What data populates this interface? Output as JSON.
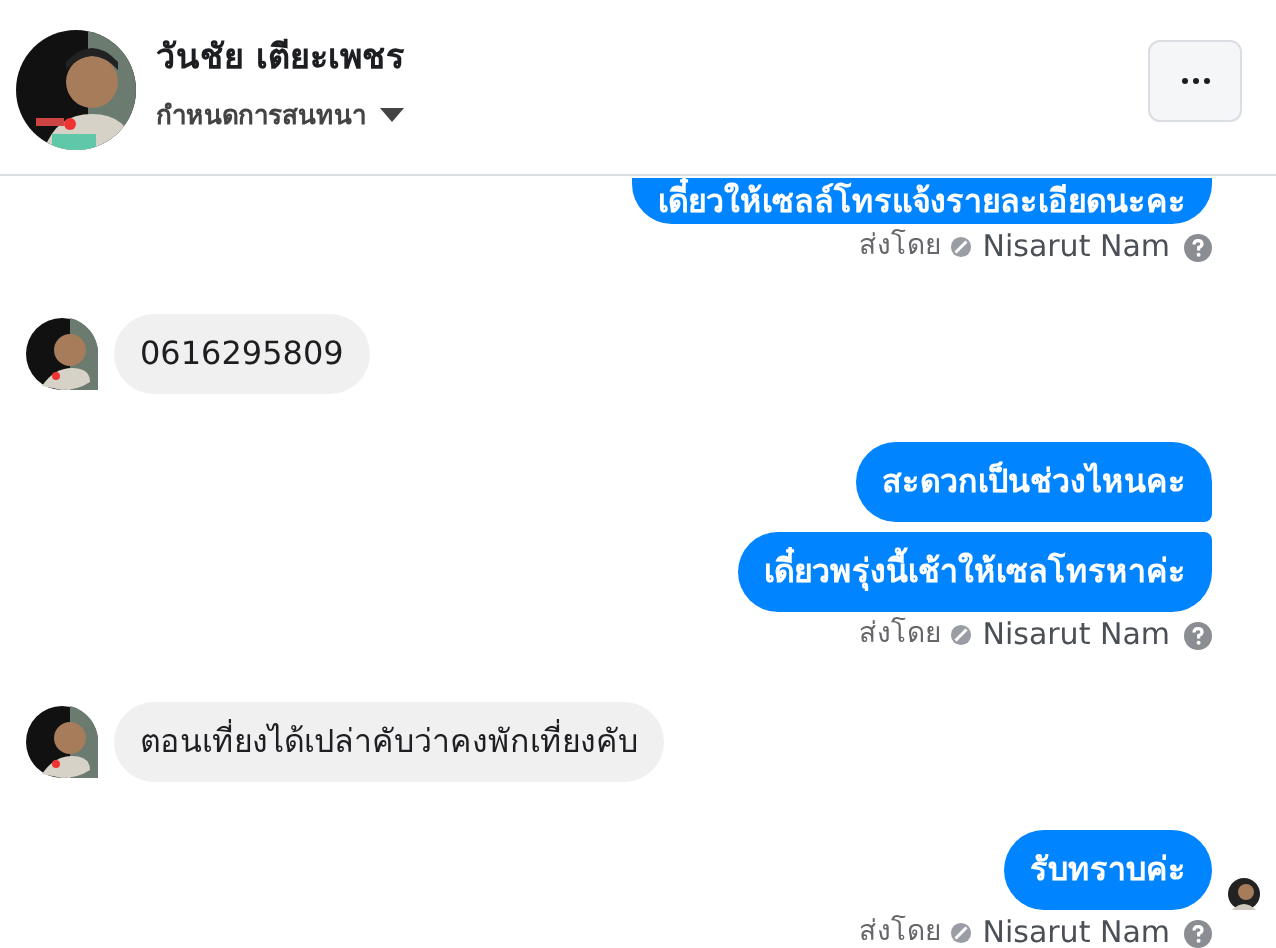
{
  "header": {
    "name": "วันชัย เตียะเพชร",
    "subtitle": "กำหนดการสนทนา"
  },
  "messages": [
    {
      "kind": "sent",
      "text": "เดี๋ยวให้เซลล์โทรแจ้งรายละเอียดนะคะ",
      "seen": false
    },
    {
      "kind": "note",
      "label": "ส่งโดย",
      "sender": "Nisarut Nam"
    },
    {
      "kind": "received",
      "text": "0616295809"
    },
    {
      "kind": "sent",
      "text": "สะดวกเป็นช่วงไหนคะ",
      "seen": false
    },
    {
      "kind": "sent",
      "text": "เดี๋ยวพรุ่งนี้เช้าให้เซลโทรหาค่ะ",
      "seen": false
    },
    {
      "kind": "note",
      "label": "ส่งโดย",
      "sender": "Nisarut Nam"
    },
    {
      "kind": "received",
      "text": "ตอนเที่ยงได้เปล่าคับว่าคงพักเที่ยงคับ"
    },
    {
      "kind": "sent",
      "text": "รับทราบค่ะ",
      "seen": true
    },
    {
      "kind": "note",
      "label": "ส่งโดย",
      "sender": "Nisarut Nam"
    }
  ]
}
